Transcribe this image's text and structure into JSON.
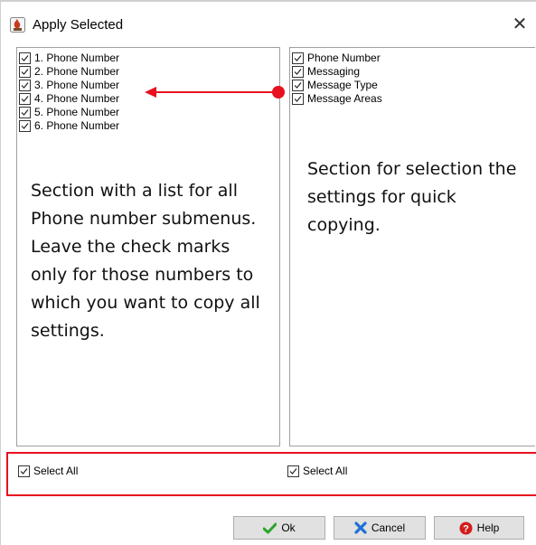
{
  "window": {
    "title": "Apply Selected",
    "close_glyph": "✕"
  },
  "left_panel": {
    "items": [
      {
        "label": "1. Phone Number",
        "checked": true
      },
      {
        "label": "2. Phone Number",
        "checked": true
      },
      {
        "label": "3. Phone Number",
        "checked": true
      },
      {
        "label": "4. Phone Number",
        "checked": true
      },
      {
        "label": "5. Phone Number",
        "checked": true
      },
      {
        "label": "6. Phone Number",
        "checked": true
      }
    ],
    "annotation": "Section with a list for all Phone number submenus. Leave the check marks only for those numbers to which you want to copy all settings.",
    "select_all_label": "Select All"
  },
  "right_panel": {
    "items": [
      {
        "label": "Phone Number",
        "checked": true
      },
      {
        "label": "Messaging",
        "checked": true
      },
      {
        "label": "Message Type",
        "checked": true
      },
      {
        "label": "Message Areas",
        "checked": true
      }
    ],
    "annotation": "Section for selection the settings for quick copying.",
    "select_all_label": "Select All"
  },
  "buttons": {
    "ok": "Ok",
    "cancel": "Cancel",
    "help": "Help"
  },
  "colors": {
    "annotation_red": "#e8101f",
    "ok_green": "#2aa52a",
    "cancel_blue": "#1f6fd6",
    "help_red": "#d21d1d"
  }
}
